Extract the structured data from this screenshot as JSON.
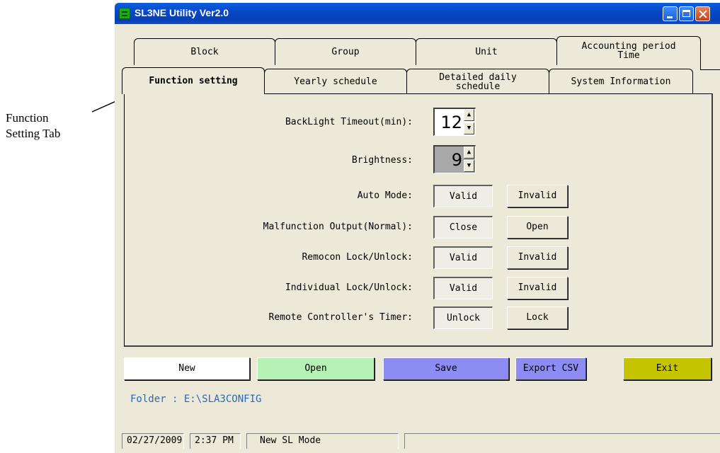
{
  "annotation": {
    "line1": "Function",
    "line2": "Setting Tab"
  },
  "window": {
    "title": "SL3NE Utility Ver2.0"
  },
  "tabs_back": [
    {
      "label": "Block"
    },
    {
      "label": "Group"
    },
    {
      "label": "Unit"
    },
    {
      "label_line1": "Accounting period",
      "label_line2": "Time"
    }
  ],
  "tabs_front": [
    {
      "label": "Function setting",
      "active": true
    },
    {
      "label": "Yearly schedule"
    },
    {
      "label_line1": "Detailed daily",
      "label_line2": "schedule"
    },
    {
      "label": "System Information"
    }
  ],
  "settings": {
    "backlight": {
      "label": "BackLight Timeout(min):",
      "value": "12"
    },
    "brightness": {
      "label": "Brightness:",
      "value": "9"
    },
    "auto_mode": {
      "label": "Auto Mode:",
      "opt1": "Valid",
      "opt2": "Invalid",
      "selected": "Valid"
    },
    "malfunction": {
      "label": "Malfunction Output(Normal):",
      "opt1": "Close",
      "opt2": "Open",
      "selected": "Close"
    },
    "remocon": {
      "label": "Remocon Lock/Unlock:",
      "opt1": "Valid",
      "opt2": "Invalid",
      "selected": "Valid"
    },
    "individual": {
      "label": "Individual Lock/Unlock:",
      "opt1": "Valid",
      "opt2": "Invalid",
      "selected": "Valid"
    },
    "remote_timer": {
      "label": "Remote Controller's Timer:",
      "opt1": "Unlock",
      "opt2": "Lock",
      "selected": "Unlock"
    }
  },
  "buttons": {
    "new": "New",
    "open": "Open",
    "save": "Save",
    "export": "Export CSV",
    "exit": "Exit"
  },
  "colors": {
    "new": "#ffffff",
    "open": "#b6f2b6",
    "save": "#8c8cf2",
    "export": "#8c8cf2",
    "exit": "#c4c400",
    "brightness_field": "#a8a8a8"
  },
  "folder": "Folder : E:\\SLA3CONFIG",
  "status": {
    "date": "02/27/2009",
    "time": "2:37 PM",
    "mode": "New SL Mode"
  }
}
